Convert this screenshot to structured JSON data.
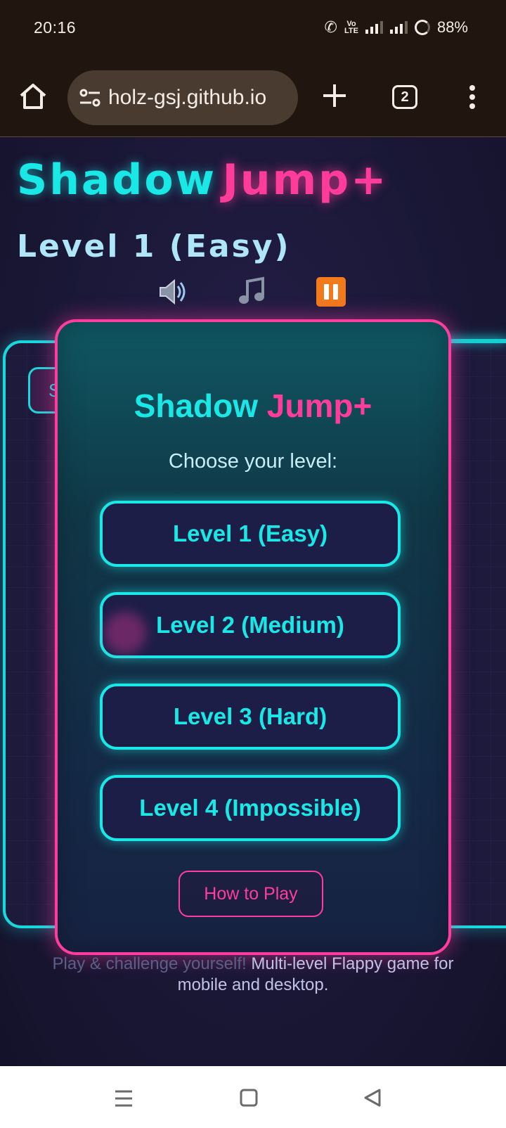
{
  "status_bar": {
    "time": "20:16",
    "battery": "88%",
    "volte": "Vo\nLTE"
  },
  "browser": {
    "url": "holz-gsj.github.io",
    "tab_count": "2",
    "icons": [
      "home-icon",
      "site-settings-icon",
      "plus-icon",
      "tab-switcher-icon",
      "more-vert-icon"
    ]
  },
  "page": {
    "title_shadow": "Shadow",
    "title_jump": "Jump+",
    "title_level": "Level 1 (Easy)",
    "controls": [
      "speaker-icon",
      "music-note-icon",
      "pause-icon"
    ],
    "canvas_button_peek": "S"
  },
  "modal": {
    "title_shadow": "Shadow",
    "title_jump": "Jump+",
    "prompt": "Choose your level:",
    "levels": [
      "Level 1 (Easy)",
      "Level 2 (Medium)",
      "Level 3 (Hard)",
      "Level 4 (Impossible)"
    ],
    "how_to_play": "How to Play"
  },
  "footer": {
    "faded": "Play & challenge yourself!",
    "main_line1": "Multi-level Flappy game for",
    "main_line2": "mobile and desktop."
  },
  "colors": {
    "cyan": "#19e8e6",
    "pink": "#ff3c9a",
    "pause_orange": "#f07a1c"
  },
  "navbar": {
    "icons": [
      "recents-icon",
      "home-icon",
      "back-icon"
    ]
  }
}
